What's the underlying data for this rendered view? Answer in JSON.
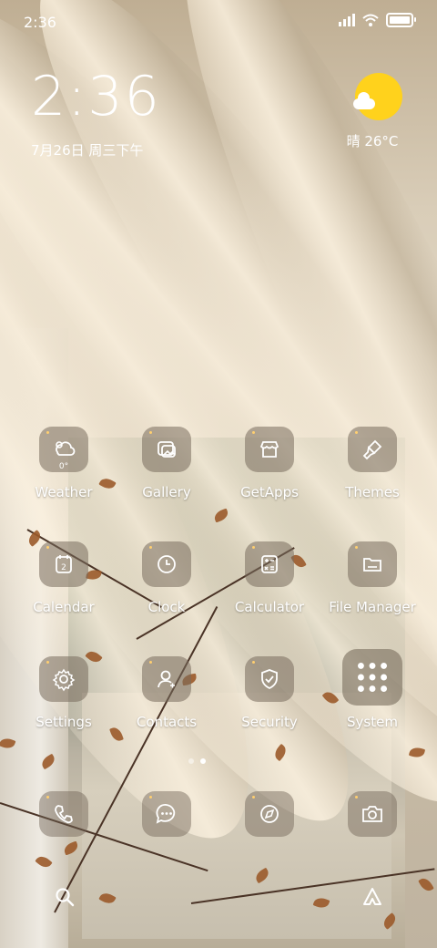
{
  "status_bar": {
    "time": "2:36",
    "battery_level": 1.0
  },
  "clock_widget": {
    "time": "2:36",
    "date": "7月26日 周三下午"
  },
  "weather_widget": {
    "text": "晴 26°C",
    "icon": "sunny-cloud-icon",
    "sun_color": "#ffd21c"
  },
  "apps": [
    {
      "label": "Weather",
      "icon": "weather-icon"
    },
    {
      "label": "Gallery",
      "icon": "gallery-icon"
    },
    {
      "label": "GetApps",
      "icon": "store-icon"
    },
    {
      "label": "Themes",
      "icon": "brush-icon"
    },
    {
      "label": "Calendar",
      "icon": "calendar-icon"
    },
    {
      "label": "Clock",
      "icon": "clock-icon"
    },
    {
      "label": "Calculator",
      "icon": "calculator-icon"
    },
    {
      "label": "File Manager",
      "icon": "folder-icon"
    },
    {
      "label": "Settings",
      "icon": "gear-icon"
    },
    {
      "label": "Contacts",
      "icon": "contacts-icon"
    },
    {
      "label": "Security",
      "icon": "shield-icon"
    },
    {
      "label": "System",
      "icon": "folder-grid-icon"
    }
  ],
  "weather_tile_badge": "0°",
  "calendar_tile_day": "2",
  "page_indicator": {
    "count": 2,
    "active": 1
  },
  "dock": [
    {
      "icon": "phone-icon"
    },
    {
      "icon": "messages-icon"
    },
    {
      "icon": "browser-icon"
    },
    {
      "icon": "camera-icon"
    }
  ],
  "bottom_bar": [
    {
      "icon": "search-icon"
    },
    {
      "icon": "assistant-icon"
    }
  ]
}
